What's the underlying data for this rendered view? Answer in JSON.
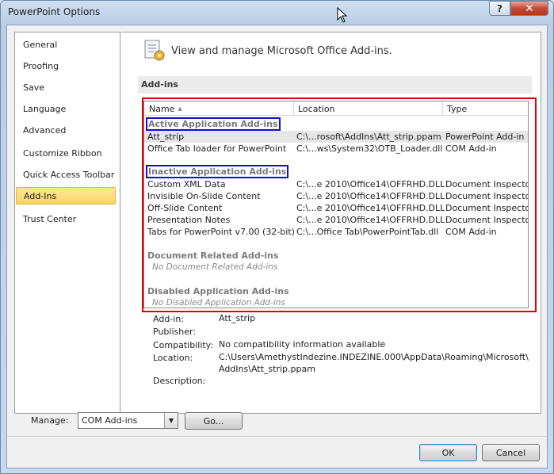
{
  "window": {
    "title": "PowerPoint Options",
    "help": "?",
    "close": "✕"
  },
  "nav": {
    "items": [
      {
        "label": "General"
      },
      {
        "label": "Proofing"
      },
      {
        "label": "Save"
      },
      {
        "label": "Language"
      },
      {
        "label": "Advanced"
      },
      {
        "label": "Customize Ribbon"
      },
      {
        "label": "Quick Access Toolbar"
      },
      {
        "label": "Add-Ins",
        "selected": true
      },
      {
        "label": "Trust Center"
      }
    ]
  },
  "header": {
    "title": "View and manage Microsoft Office Add-ins.",
    "icon": "addins-gear-icon"
  },
  "section": {
    "title": "Add-ins"
  },
  "table": {
    "columns": [
      "Name",
      "Location",
      "Type"
    ],
    "sort_indicator": "▲",
    "groups": [
      {
        "title": "Active Application Add-ins",
        "rows": [
          {
            "name": "Att_strip",
            "location": "C:\\...rosoft\\AddIns\\Att_strip.ppam",
            "type": "PowerPoint Add-in"
          },
          {
            "name": "Office Tab loader for PowerPoint",
            "location": "C:\\...ws\\System32\\OTB_Loader.dll",
            "type": "COM Add-in"
          }
        ]
      },
      {
        "title": "Inactive Application Add-ins",
        "rows": [
          {
            "name": "Custom XML Data",
            "location": "C:\\...e 2010\\Office14\\OFFRHD.DLL",
            "type": "Document Inspector"
          },
          {
            "name": "Invisible On-Slide Content",
            "location": "C:\\...e 2010\\Office14\\OFFRHD.DLL",
            "type": "Document Inspector"
          },
          {
            "name": "Off-Slide Content",
            "location": "C:\\...e 2010\\Office14\\OFFRHD.DLL",
            "type": "Document Inspector"
          },
          {
            "name": "Presentation Notes",
            "location": "C:\\...e 2010\\Office14\\OFFRHD.DLL",
            "type": "Document Inspector"
          },
          {
            "name": "Tabs for PowerPoint v7.00 (32-bit)",
            "location": "C:\\...Office Tab\\PowerPointTab.dll",
            "type": "COM Add-in"
          }
        ]
      },
      {
        "title": "Document Related Add-ins",
        "empty": "No Document Related Add-ins"
      },
      {
        "title": "Disabled Application Add-ins",
        "empty": "No Disabled Application Add-ins"
      }
    ]
  },
  "details": {
    "addin_label": "Add-in:",
    "addin_value": "Att_strip",
    "publisher_label": "Publisher:",
    "publisher_value": "",
    "compat_label": "Compatibility:",
    "compat_value": "No compatibility information available",
    "location_label": "Location:",
    "location_line1": "C:\\Users\\AmethystIndezine.INDEZINE.000\\AppData\\Roaming\\Microsoft\\",
    "location_line2": "AddIns\\Att_strip.ppam",
    "description_label": "Description:",
    "description_value": ""
  },
  "manage": {
    "label": "Manage:",
    "selected": "COM Add-ins",
    "go": "Go..."
  },
  "buttons": {
    "ok": "OK",
    "cancel": "Cancel"
  },
  "colors": {
    "highlight_red": "#e00000",
    "highlight_blue": "#1010c8",
    "nav_selected": "#fbd463"
  }
}
